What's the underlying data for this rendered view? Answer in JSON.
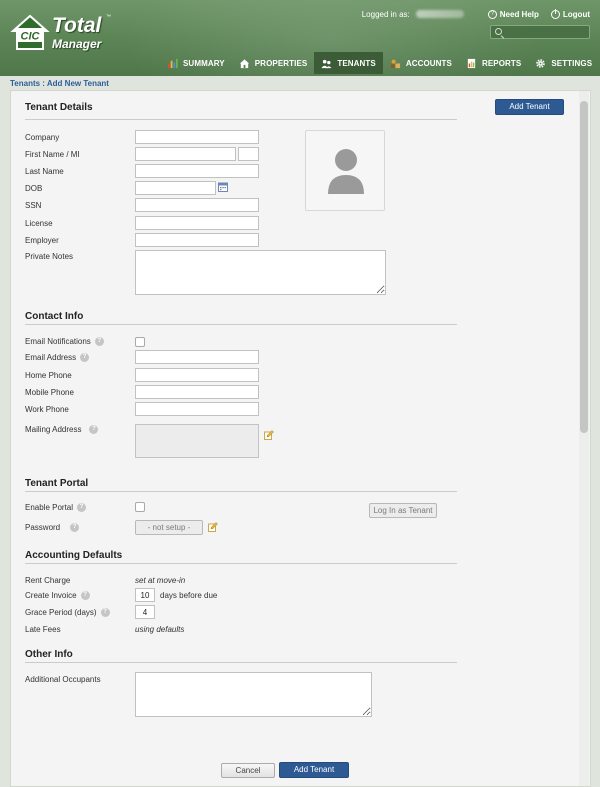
{
  "header": {
    "logo_badge": "CIC",
    "logo_total": "Total",
    "logo_manager": "Manager",
    "logo_tm": "™",
    "logged_in_label": "Logged in as:",
    "need_help": "Need Help",
    "logout": "Logout",
    "search_placeholder": ""
  },
  "nav": {
    "items": [
      {
        "label": "SUMMARY",
        "icon": "bar-chart-icon"
      },
      {
        "label": "PROPERTIES",
        "icon": "house-icon"
      },
      {
        "label": "TENANTS",
        "icon": "people-icon",
        "active": true
      },
      {
        "label": "ACCOUNTS",
        "icon": "money-bag-icon"
      },
      {
        "label": "REPORTS",
        "icon": "report-icon"
      },
      {
        "label": "SETTINGS",
        "icon": "gear-icon"
      }
    ]
  },
  "breadcrumb": "Tenants : Add New Tenant",
  "tenant_details": {
    "title": "Tenant Details",
    "add_button": "Add Tenant",
    "company": "Company",
    "first_name": "First Name / MI",
    "last_name": "Last Name",
    "dob": "DOB",
    "ssn": "SSN",
    "license": "License",
    "employer": "Employer",
    "private_notes": "Private Notes"
  },
  "contact_info": {
    "title": "Contact Info",
    "email_notifications": "Email Notifications",
    "email_address": "Email Address",
    "home_phone": "Home Phone",
    "mobile_phone": "Mobile Phone",
    "work_phone": "Work Phone",
    "mailing_address": "Mailing Address"
  },
  "tenant_portal": {
    "title": "Tenant Portal",
    "enable_portal": "Enable Portal",
    "password": "Password",
    "password_value": "- not setup -",
    "login_as_tenant": "Log In as Tenant"
  },
  "accounting": {
    "title": "Accounting Defaults",
    "rent_charge": "Rent Charge",
    "rent_charge_value": "set at move-in",
    "create_invoice": "Create Invoice",
    "create_invoice_value": "10",
    "days_before_due": "days before due",
    "grace_period": "Grace Period (days)",
    "grace_period_value": "4",
    "late_fees": "Late Fees",
    "late_fees_value": "using defaults"
  },
  "other_info": {
    "title": "Other Info",
    "additional_occupants": "Additional Occupants"
  },
  "footer": {
    "cancel": "Cancel",
    "add_tenant": "Add Tenant"
  },
  "colors": {
    "header_green": "#5c8556",
    "nav_active": "#3b5c37",
    "primary_blue": "#2d5a93",
    "breadcrumb_blue": "#2e5d9a"
  }
}
